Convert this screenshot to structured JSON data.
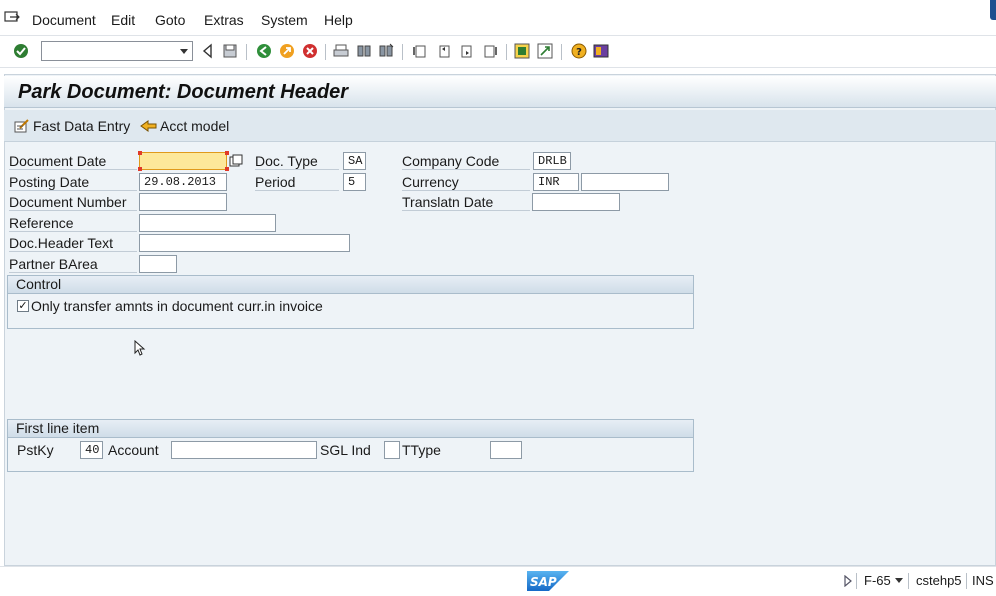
{
  "menu": {
    "items": [
      {
        "label": "Document"
      },
      {
        "label": "Edit"
      },
      {
        "label": "Goto"
      },
      {
        "label": "Extras"
      },
      {
        "label": "System"
      },
      {
        "label": "Help"
      }
    ]
  },
  "toolbar": {
    "command_field_value": ""
  },
  "page": {
    "title": "Park Document: Document Header"
  },
  "app_toolbar": {
    "fast_data_entry": "Fast Data Entry",
    "acct_model": "Acct model"
  },
  "header": {
    "document_date": {
      "label": "Document Date",
      "value": ""
    },
    "doc_type": {
      "label": "Doc. Type",
      "value": "SA"
    },
    "company_code": {
      "label": "Company Code",
      "value": "DRLB"
    },
    "posting_date": {
      "label": "Posting Date",
      "value": "29.08.2013"
    },
    "period": {
      "label": "Period",
      "value": "5"
    },
    "currency": {
      "label": "Currency",
      "value": "INR",
      "rate_value": ""
    },
    "document_number": {
      "label": "Document Number",
      "value": ""
    },
    "translatn_date": {
      "label": "Translatn Date",
      "value": ""
    },
    "reference": {
      "label": "Reference",
      "value": ""
    },
    "doc_header_text": {
      "label": "Doc.Header Text",
      "value": ""
    },
    "partner_barea": {
      "label": "Partner BArea",
      "value": ""
    }
  },
  "control": {
    "title": "Control",
    "only_transfer": {
      "label": "Only transfer amnts in document curr.in invoice",
      "checked": "✓"
    }
  },
  "first_line_item": {
    "title": "First line item",
    "pstky": {
      "label": "PstKy",
      "value": "40"
    },
    "account": {
      "label": "Account",
      "value": ""
    },
    "sgl_ind": {
      "label": "SGL Ind",
      "value": ""
    },
    "ttype": {
      "label": "TType",
      "value": ""
    }
  },
  "status": {
    "transaction": "F-65",
    "server": "cstehp5",
    "mode": "INS"
  },
  "colors": {
    "focus_field": "#fde89a",
    "required_marker": "#e03a2a",
    "group_border": "#a9bccb",
    "content_bg": "#eef3f7"
  }
}
